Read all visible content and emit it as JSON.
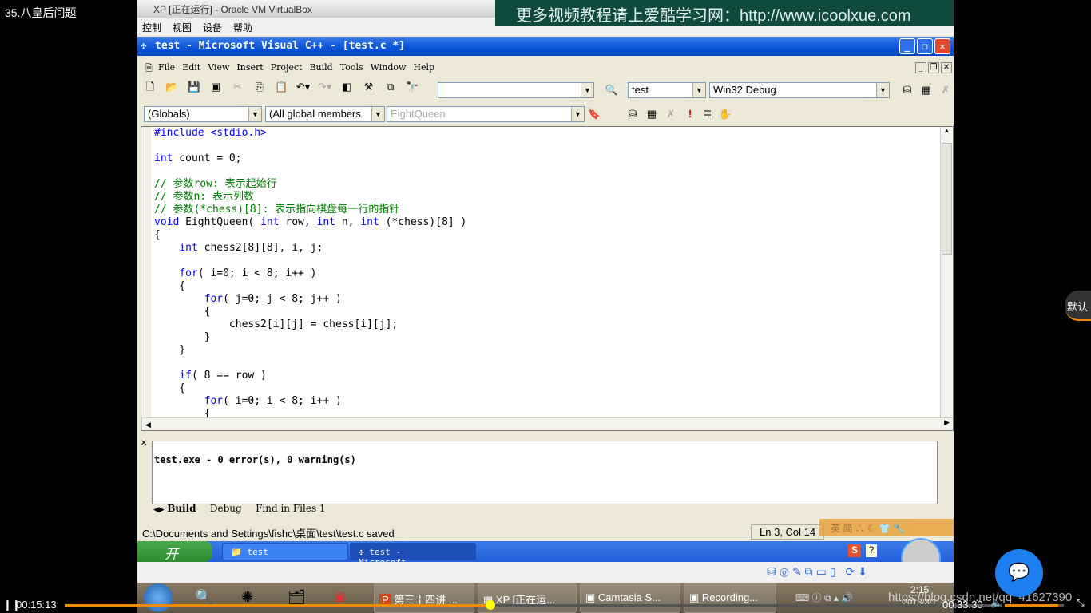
{
  "video": {
    "title": "35.八皇后问题",
    "current_time": "00:15:13",
    "total_time": "00:33:30",
    "progress_percent": 45.4,
    "volume_percent": 90,
    "side_badge": "默认",
    "url_watermark": "https://blog.csdn.net/qq_41627390",
    "accent": "#f08a00"
  },
  "vbox": {
    "title": "XP [正在运行] - Oracle VM VirtualBox",
    "menu": [
      "控制",
      "视图",
      "设备",
      "帮助"
    ],
    "watermark": "更多视频教程请上爱酷学习网：http://www.icoolxue.com"
  },
  "vc": {
    "title": "test - Microsoft Visual C++ - [test.c *]",
    "menu": [
      "File",
      "Edit",
      "View",
      "Insert",
      "Project",
      "Build",
      "Tools",
      "Window",
      "Help"
    ],
    "find_combo": "",
    "project_combo": "test",
    "config_combo": "Win32 Debug",
    "scope_combo": "(Globals)",
    "members_combo": "(All global members",
    "function_combo": "EightQueen",
    "code": [
      [
        [
          "#include <stdio.h>",
          "kw"
        ]
      ],
      [],
      [
        [
          "int",
          "kw"
        ],
        [
          " count = 0;",
          "tx"
        ]
      ],
      [],
      [
        [
          "// 参数row: 表示起始行",
          "cm"
        ]
      ],
      [
        [
          "// 参数n: 表示列数",
          "cm"
        ]
      ],
      [
        [
          "// 参数(*chess)[8]: 表示指向棋盘每一行的指针",
          "cm"
        ]
      ],
      [
        [
          "void",
          "kw"
        ],
        [
          " EightQueen( ",
          "tx"
        ],
        [
          "int",
          "kw"
        ],
        [
          " row, ",
          "tx"
        ],
        [
          "int",
          "kw"
        ],
        [
          " n, ",
          "tx"
        ],
        [
          "int",
          "kw"
        ],
        [
          " (*chess)[8] )",
          "tx"
        ]
      ],
      [
        [
          "{",
          "tx"
        ]
      ],
      [
        [
          "    ",
          "tx"
        ],
        [
          "int",
          "kw"
        ],
        [
          " chess2[8][8], i, j;",
          "tx"
        ]
      ],
      [],
      [
        [
          "    ",
          "tx"
        ],
        [
          "for",
          "kw"
        ],
        [
          "( i=0; i < 8; i++ )",
          "tx"
        ]
      ],
      [
        [
          "    {",
          "tx"
        ]
      ],
      [
        [
          "        ",
          "tx"
        ],
        [
          "for",
          "kw"
        ],
        [
          "( j=0; j < 8; j++ )",
          "tx"
        ]
      ],
      [
        [
          "        {",
          "tx"
        ]
      ],
      [
        [
          "            chess2[i][j] = chess[i][j];",
          "tx"
        ]
      ],
      [
        [
          "        }",
          "tx"
        ]
      ],
      [
        [
          "    }",
          "tx"
        ]
      ],
      [],
      [
        [
          "    ",
          "tx"
        ],
        [
          "if",
          "kw"
        ],
        [
          "( 8 == row )",
          "tx"
        ]
      ],
      [
        [
          "    {",
          "tx"
        ]
      ],
      [
        [
          "        ",
          "tx"
        ],
        [
          "for",
          "kw"
        ],
        [
          "( i=0; i < 8; i++ )",
          "tx"
        ]
      ],
      [
        [
          "        {",
          "tx"
        ]
      ]
    ],
    "output_text": "test.exe - 0 error(s), 0 warning(s)",
    "output_tabs": [
      "Build",
      "Debug",
      "Find in Files 1"
    ],
    "status_text": "C:\\Documents and Settings\\fishc\\桌面\\test\\test.c saved",
    "cursor_pos": "Ln 3, Col 14",
    "ime_bar": "英 简"
  },
  "xp": {
    "start": "开始",
    "tasks": [
      "test",
      "test - Microsoft..."
    ]
  },
  "win7": {
    "tasks": [
      "第三十四讲 ...",
      "XP [正在运...",
      "Camtasia S...",
      "Recording..."
    ],
    "clock": "2:15",
    "date": "2018/3/1"
  }
}
